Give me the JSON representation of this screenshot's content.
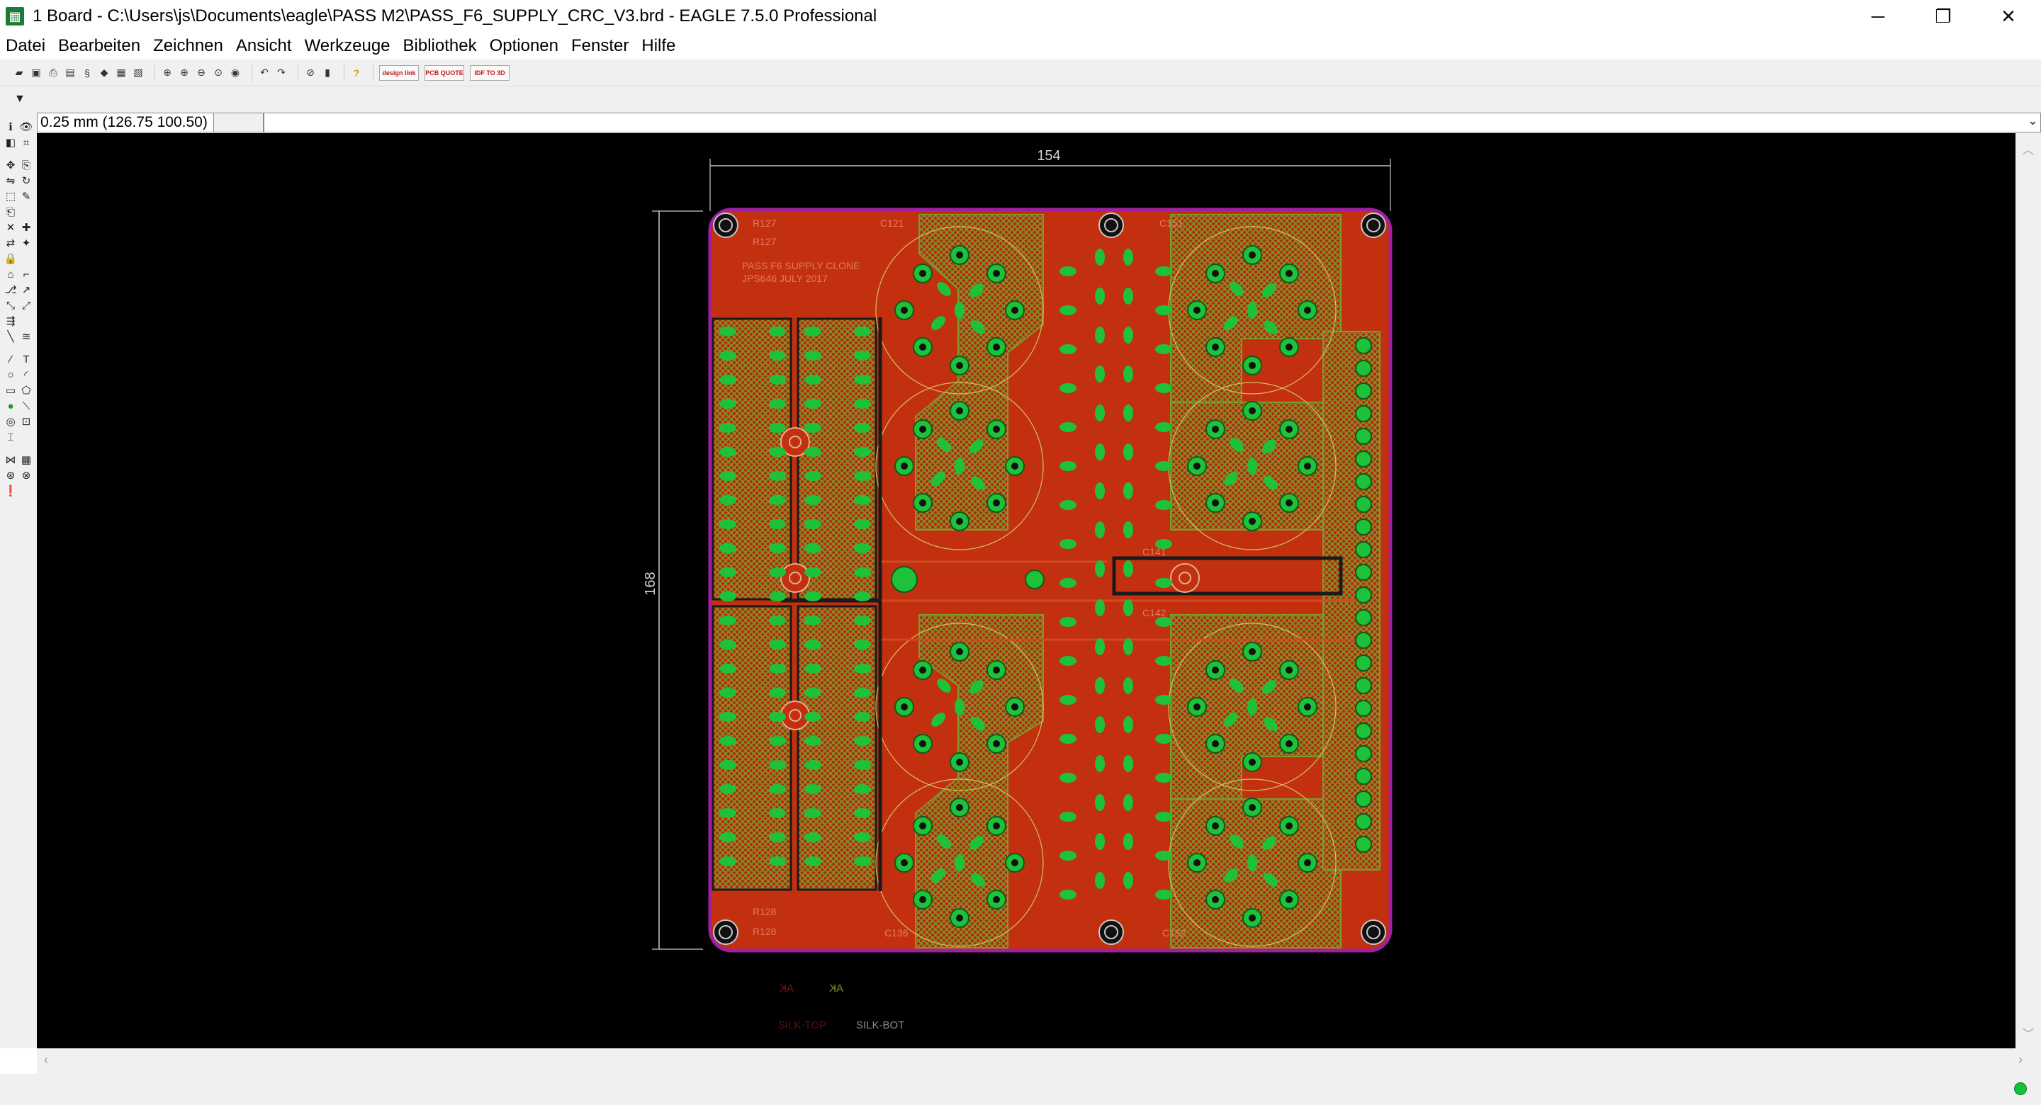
{
  "window": {
    "title": "1 Board - C:\\Users\\js\\Documents\\eagle\\PASS M2\\PASS_F6_SUPPLY_CRC_V3.brd - EAGLE 7.5.0 Professional",
    "app_icon": "eagle-board-icon",
    "minimize_glyph": "─",
    "maximize_glyph": "❐",
    "close_glyph": "✕"
  },
  "menu": {
    "items": [
      "Datei",
      "Bearbeiten",
      "Zeichnen",
      "Ansicht",
      "Werkzeuge",
      "Bibliothek",
      "Optionen",
      "Fenster",
      "Hilfe"
    ]
  },
  "toolbar": {
    "icons": [
      "open-icon",
      "save-icon",
      "print-icon",
      "cam-icon",
      "script-icon",
      "run-ulp-icon",
      "layer-icon",
      "display-icon",
      "zoom-fit-icon",
      "zoom-in-icon",
      "zoom-out-icon",
      "zoom-select-icon",
      "redraw-icon",
      "undo-icon",
      "redo-icon",
      "stop-icon",
      "go-icon",
      "help-icon"
    ],
    "wide_buttons": [
      {
        "name": "design-link-button",
        "label": "design link"
      },
      {
        "name": "pcb-quote-button",
        "label": "PCB QUOTE"
      },
      {
        "name": "idf-export-button",
        "label": "IDF TO 3D"
      }
    ]
  },
  "coordinates": {
    "readout": "0.25 mm (126.75 100.50)",
    "command_value": ""
  },
  "board": {
    "dimension_width": "154",
    "dimension_height": "168",
    "silk_title_line1": "PASS F6 SUPPLY CLONE",
    "silk_title_line2": "JPS646 JULY 2017",
    "labels_top": [
      "R127",
      "R127",
      "C121",
      "C151",
      "C141",
      "C142"
    ],
    "labels_bottom": [
      "R128",
      "R128",
      "C136",
      "C152"
    ],
    "layer_legend": [
      "SILK-TOP",
      "SILK-BOT"
    ],
    "mirror_marks": [
      "AK",
      "AK"
    ],
    "colors": {
      "background": "#000000",
      "copper_top": "#c3300f",
      "copper_pour": "#b52a0c",
      "hatch": "#6f8a2a",
      "pads": "#1ec23a",
      "outline": "#a020a0",
      "trace_dark": "#1a1a1a",
      "dimension": "#c8c8c8"
    }
  },
  "status": {
    "message": "",
    "led": "ready-led-icon"
  }
}
